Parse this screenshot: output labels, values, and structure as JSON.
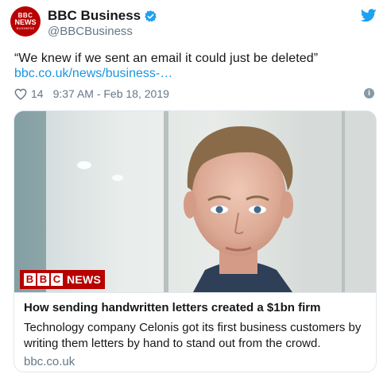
{
  "account": {
    "name": "BBC Business",
    "handle": "@BBCBusiness",
    "avatar": {
      "line1": "BBC",
      "line2": "NEWS",
      "line3": "BUSINESS"
    }
  },
  "tweet": {
    "text": "“We knew if we sent an email it could just be deleted”",
    "link": "bbc.co.uk/news/business-…",
    "likes": "14",
    "timestamp": "9:37 AM - Feb 18, 2019"
  },
  "card": {
    "logo": {
      "blocks": [
        "B",
        "B",
        "C"
      ],
      "word": "NEWS"
    },
    "title": "How sending handwritten letters created a $1bn firm",
    "description": "Technology company Celonis got its first business customers by writing them letters by hand to stand out from the crowd.",
    "domain": "bbc.co.uk"
  },
  "icons": {
    "verified": "verified-badge-icon",
    "twitter": "twitter-bird-icon",
    "like": "heart-icon",
    "info": "info-icon"
  },
  "colors": {
    "brand_red": "#b80000",
    "twitter_blue": "#1da1f2",
    "link_blue": "#1b95e0",
    "muted": "#657786"
  }
}
